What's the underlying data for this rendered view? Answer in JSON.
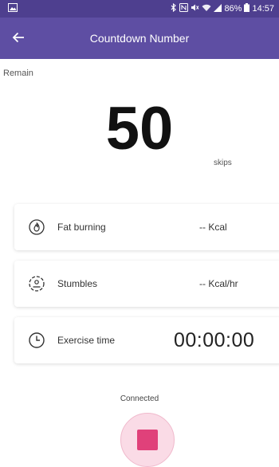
{
  "status_bar": {
    "icons": [
      "image-icon",
      "bluetooth-icon",
      "nfc-icon",
      "mute-icon",
      "wifi-icon",
      "signal-icon",
      "battery-icon"
    ],
    "battery": "86%",
    "time": "14:57",
    "background": "#4e3f8f"
  },
  "app_bar": {
    "title": "Countdown Number",
    "background": "#5e4ea3"
  },
  "remain": {
    "label": "Remain",
    "value": "50",
    "unit": "skips"
  },
  "stats": [
    {
      "label": "Fat burning",
      "value": "-- Kcal",
      "icon": "fire-icon"
    },
    {
      "label": "Stumbles",
      "value": "-- Kcal/hr",
      "icon": "stumble-icon"
    },
    {
      "label": "Exercise time",
      "value": "00:00:00",
      "icon": "clock-icon"
    }
  ],
  "connection": {
    "status": "Connected"
  },
  "stop_button": {
    "accent": "#e0417a"
  }
}
